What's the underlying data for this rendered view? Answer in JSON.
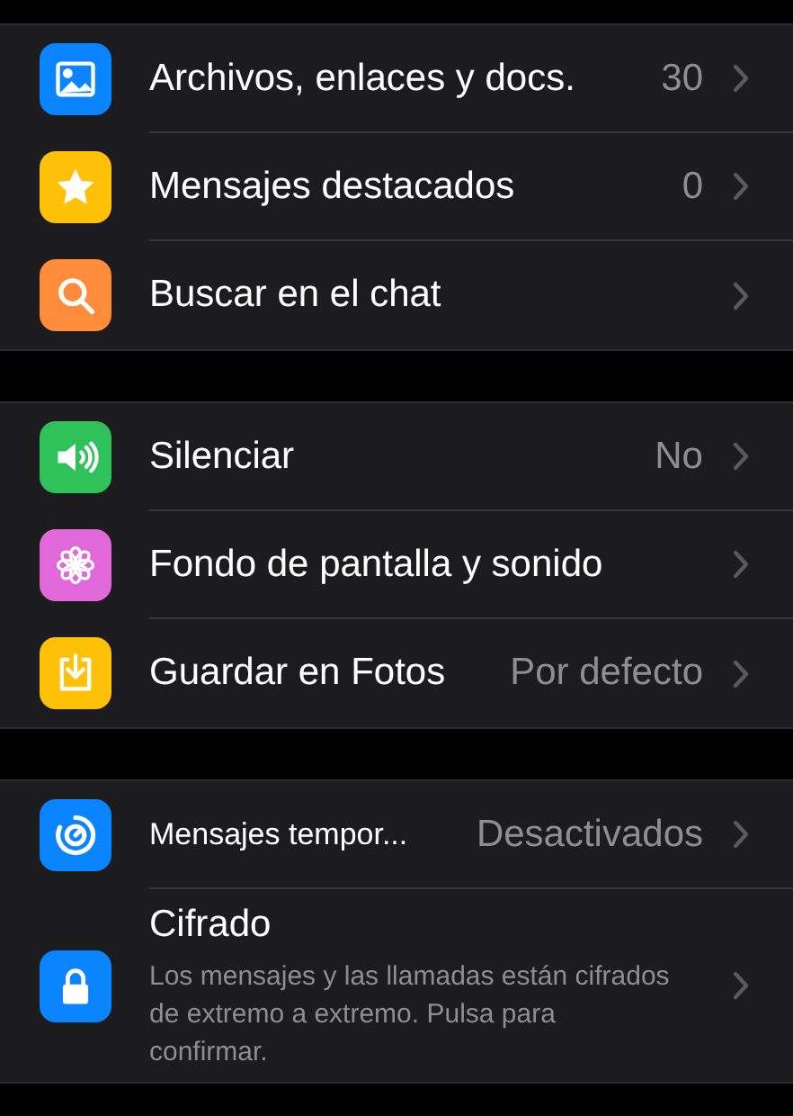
{
  "groups": [
    {
      "rows": [
        {
          "kind": "default",
          "color": "#0a84ff",
          "label": "Archivos, enlaces y docs.",
          "value": "30"
        },
        {
          "kind": "default",
          "color": "#ffc107",
          "label": "Mensajes destacados",
          "value": "0"
        },
        {
          "kind": "default",
          "color": "#ff8c3a",
          "label": "Buscar en el chat"
        }
      ]
    },
    {
      "rows": [
        {
          "kind": "default",
          "color": "#30c25a",
          "label": "Silenciar",
          "value": "No"
        },
        {
          "kind": "default",
          "color": "#e068d8",
          "label": "Fondo de pantalla y sonido"
        },
        {
          "kind": "default",
          "color": "#ffc107",
          "label": "Guardar en Fotos",
          "value": "Por defecto"
        }
      ]
    },
    {
      "rows": [
        {
          "kind": "condensed",
          "color": "#0a84ff",
          "label": "Mensajes tempor...",
          "value": "Desactivados"
        },
        {
          "kind": "description",
          "color": "#0a84ff",
          "label": "Cifrado",
          "description": "Los mensajes y las llamadas están cifrados de extremo a extremo. Pulsa para confirmar."
        }
      ]
    }
  ]
}
